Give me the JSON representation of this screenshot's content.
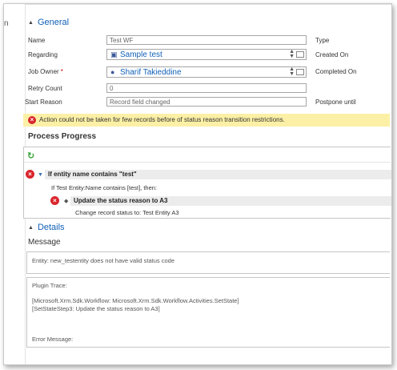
{
  "left_strip": {
    "text": "n"
  },
  "general": {
    "title": "General",
    "fields": {
      "name": {
        "label": "Name",
        "value": "Test WF"
      },
      "regarding": {
        "label": "Regarding",
        "value": "Sample test"
      },
      "job_owner": {
        "label": "Job Owner",
        "required_mark": "*",
        "value": "Sharif Takieddine"
      },
      "retry_count": {
        "label": "Retry Count",
        "value": "0"
      },
      "start_reason": {
        "label": "Start Reason",
        "value": "Record field changed"
      }
    },
    "right_labels": {
      "type": "Type",
      "created_on": "Created On",
      "completed_on": "Completed On",
      "postpone_until": "Postpone until"
    }
  },
  "warning": {
    "icon": "error-icon",
    "text": "Action could not be taken for few records before of status reason transition restrictions."
  },
  "process_progress": {
    "title": "Process Progress",
    "condition_label": "If entity name contains \"test\"",
    "condition_detail": "If Test Entity:Name contains [test], then:",
    "action_label": "Update the status reason to A3",
    "action_detail": "Change record status to:  Test Entity  A3"
  },
  "details": {
    "title": "Details",
    "message_title": "Message",
    "message_text": "Entity: new_testentity does not have valid status code",
    "trace_lines": [
      "Plugin Trace:",
      "",
      "[Microsoft.Xrm.Sdk.Workflow: Microsoft.Xrm.Sdk.Workflow.Activities.SetState]",
      "[SetStateStep3: Update the status reason to A3]",
      "",
      "",
      "",
      "Error Message:"
    ]
  },
  "colors": {
    "link": "#1160b7",
    "warning_bg": "#fcf0a6",
    "error_red": "#d9262c",
    "refresh_green": "#2e9e2e"
  }
}
